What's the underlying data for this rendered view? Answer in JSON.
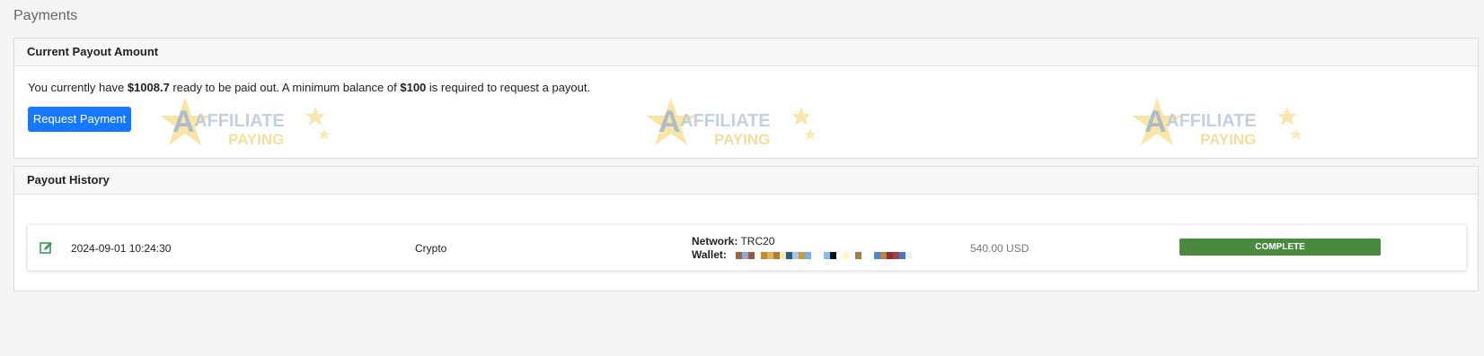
{
  "page": {
    "title": "Payments"
  },
  "current_payout": {
    "heading": "Current Payout Amount",
    "text_prefix": "You currently have ",
    "amount": "$1008.7",
    "text_middle": " ready to be paid out. A minimum balance of ",
    "minimum": "$100",
    "text_suffix": " is required to request a payout.",
    "request_button_label": "Request Payment"
  },
  "watermark": {
    "line1": "AFFILIATE",
    "line2": "PAYING"
  },
  "payout_history": {
    "heading": "Payout History",
    "rows": [
      {
        "edit_icon": "edit-icon",
        "date": "2024-09-01 10:24:30",
        "method": "Crypto",
        "network_label": "Network:",
        "network": "TRC20",
        "wallet_label": "Wallet:",
        "amount": "540.00 USD",
        "status": "COMPLETE"
      }
    ]
  },
  "colors": {
    "primary_button": "#1677ff",
    "status_complete": "#4a8a3f",
    "edit_icon": "#3a9a5a"
  }
}
